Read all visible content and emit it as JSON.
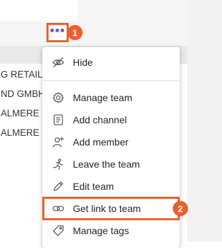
{
  "teams_list": [
    {
      "name": "G RETAILE"
    },
    {
      "name": "ND GMBH"
    },
    {
      "name": "ALMERE"
    },
    {
      "name": "ALMERE"
    }
  ],
  "more_options": {
    "label": "•••",
    "icon": "more-options-icon"
  },
  "callouts": [
    {
      "number": "1"
    },
    {
      "number": "2"
    }
  ],
  "menu": {
    "items": [
      {
        "label": "Hide",
        "icon": "hide-icon"
      },
      {
        "label": "Manage team",
        "icon": "gear-icon"
      },
      {
        "label": "Add channel",
        "icon": "channel-icon"
      },
      {
        "label": "Add member",
        "icon": "add-person-icon"
      },
      {
        "label": "Leave the team",
        "icon": "leave-icon"
      },
      {
        "label": "Edit team",
        "icon": "pencil-icon"
      },
      {
        "label": "Get link to team",
        "icon": "link-icon"
      },
      {
        "label": "Manage tags",
        "icon": "tag-icon"
      }
    ]
  },
  "colors": {
    "accent": "#e8612c",
    "brand": "#6264a7"
  }
}
